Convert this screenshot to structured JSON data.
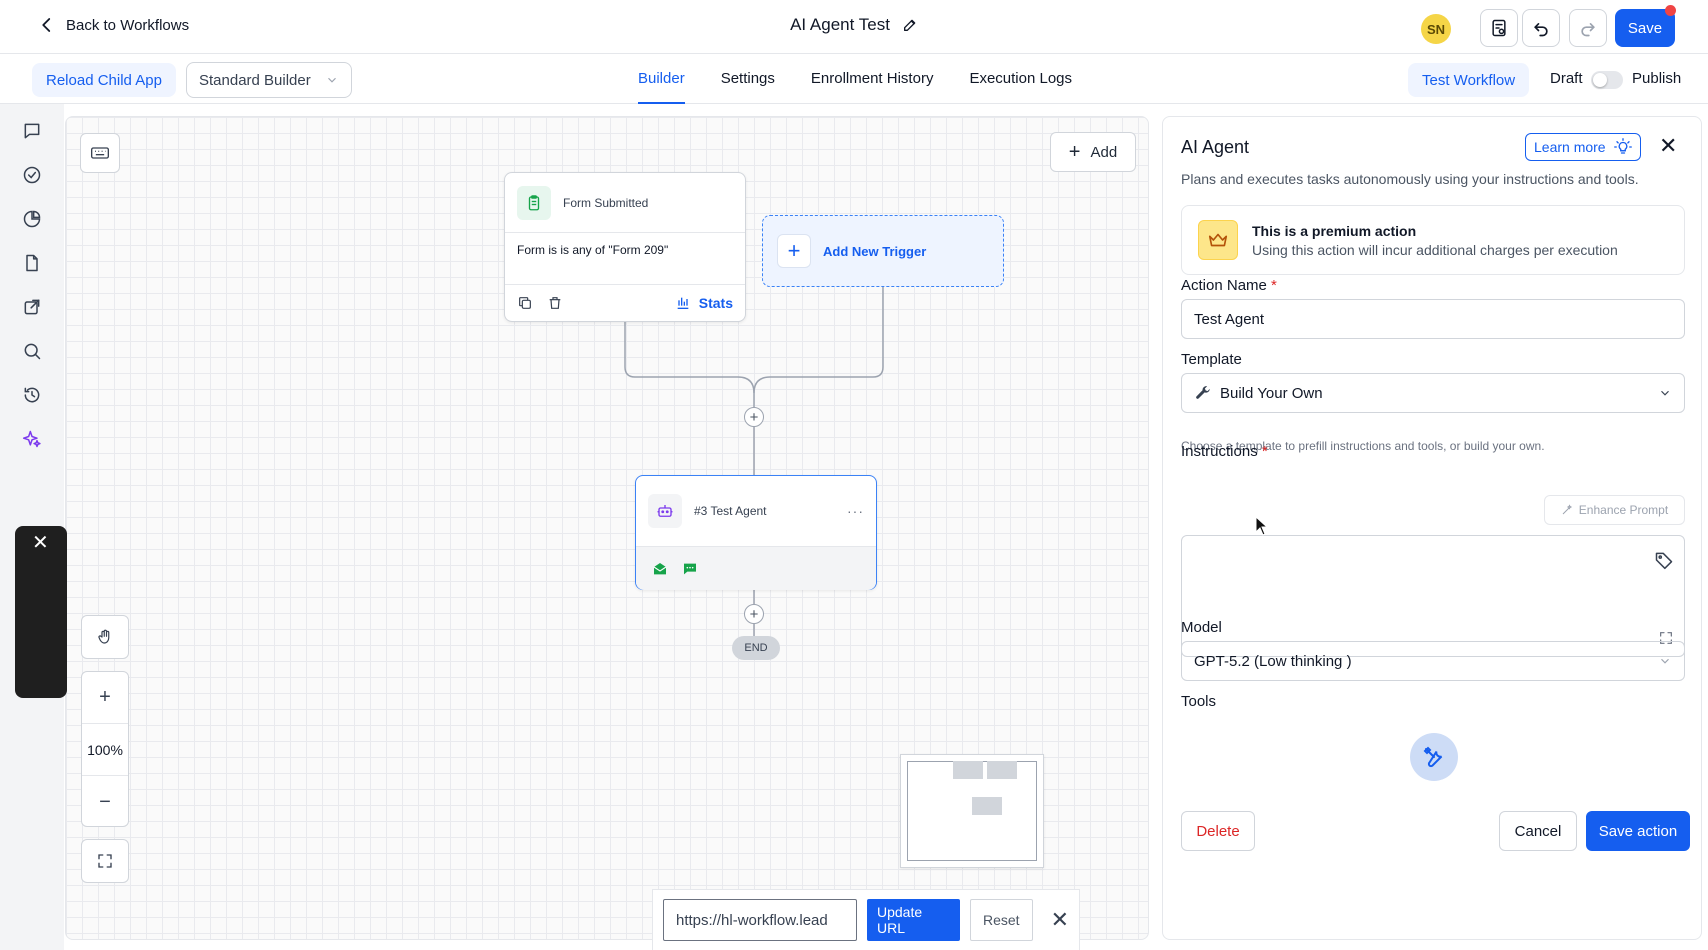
{
  "header": {
    "back_label": "Back to Workflows",
    "title": "AI Agent Test",
    "avatar_initials": "SN",
    "save_label": "Save"
  },
  "subheader": {
    "reload_label": "Reload Child App",
    "builder_select": "Standard Builder",
    "tabs": [
      {
        "label": "Builder",
        "active": true
      },
      {
        "label": "Settings",
        "active": false
      },
      {
        "label": "Enrollment History",
        "active": false
      },
      {
        "label": "Execution Logs",
        "active": false
      }
    ],
    "test_workflow_label": "Test Workflow",
    "draft_label": "Draft",
    "publish_label": "Publish",
    "publish_toggle_on": false
  },
  "canvas": {
    "add_label": "Add",
    "trigger_node": {
      "title": "Form Submitted",
      "condition": "Form is is any of \"Form 209\"",
      "stats_label": "Stats"
    },
    "new_trigger_label": "Add New Trigger",
    "agent_node": {
      "title": "#3 Test Agent",
      "more_label": "···"
    },
    "end_label": "END",
    "zoom_level": "100%",
    "url_bar": {
      "url_value": "https://hl-workflow.lead",
      "update_label": "Update URL",
      "reset_label": "Reset"
    }
  },
  "panel": {
    "title": "AI Agent",
    "learn_more_label": "Learn more",
    "description": "Plans and executes tasks autonomously using your instructions and tools.",
    "premium_title": "This is a premium action",
    "premium_text": "Using this action will incur additional charges per execution",
    "action_name_label": "Action Name",
    "action_name_value": "Test Agent",
    "template_label": "Template",
    "template_value": "Build Your Own",
    "template_hint": "Choose a template to prefill instructions and tools, or build your own.",
    "instructions_label": "Instructions",
    "enhance_label": "Enhance Prompt",
    "instructions_value": "",
    "model_label": "Model",
    "model_value": "GPT-5.2 (Low thinking )",
    "tools_label": "Tools",
    "delete_label": "Delete",
    "cancel_label": "Cancel",
    "save_action_label": "Save action",
    "required_mark": "*"
  },
  "colors": {
    "accent": "#155eef",
    "danger": "#dc2626",
    "premium": "#fde68a",
    "notification": "#ef4444"
  }
}
